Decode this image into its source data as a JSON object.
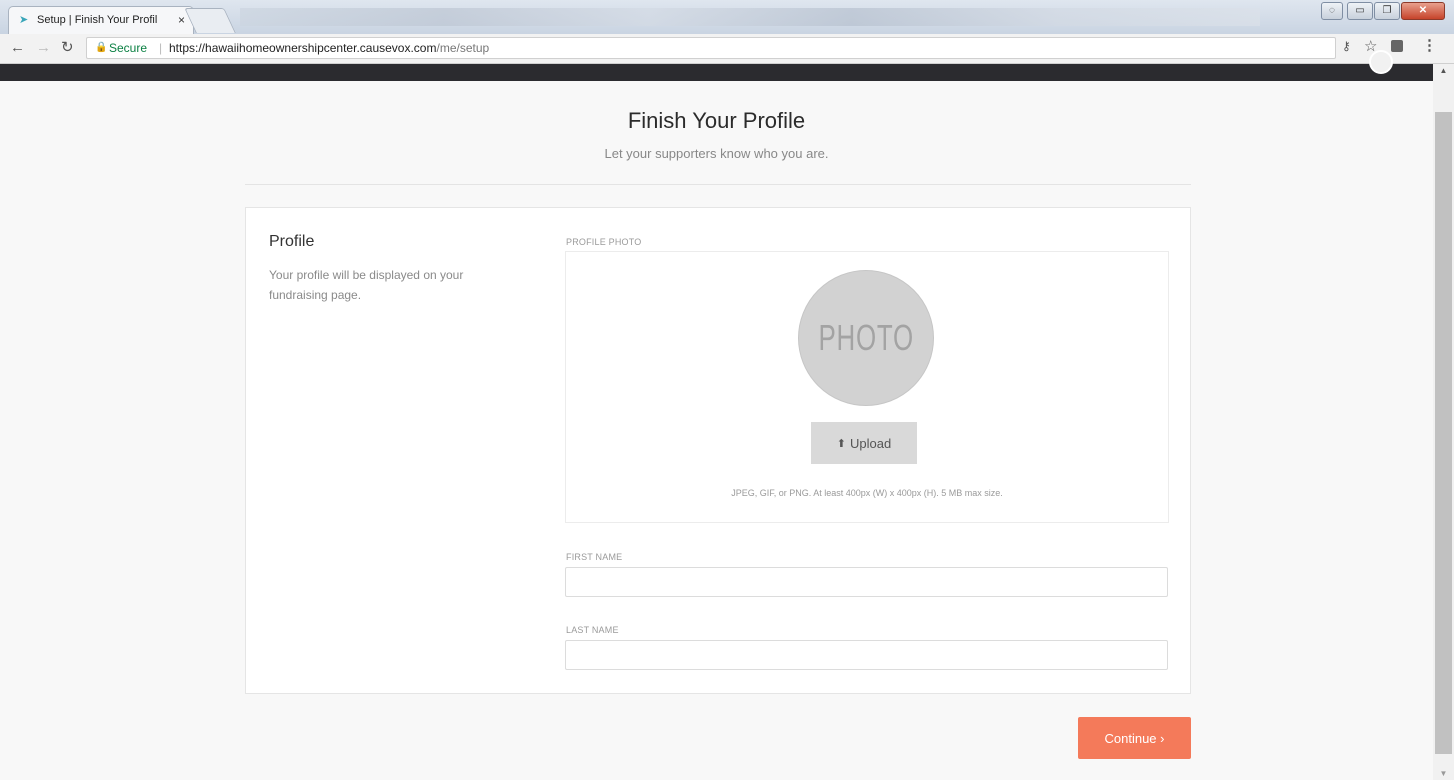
{
  "browser": {
    "tab_title": "Setup | Finish Your Profil",
    "tab_close": "×",
    "secure_label": "Secure",
    "url_host": "https://hawaiihomeownershipcenter.causevox.com",
    "url_path": "/me/setup"
  },
  "page": {
    "title": "Finish Your Profile",
    "subtitle": "Let your supporters know who you are."
  },
  "profile_section": {
    "title": "Profile",
    "description": "Your profile will be displayed on your fundraising page."
  },
  "photo": {
    "label": "PROFILE PHOTO",
    "placeholder_text": "PHOTO",
    "upload_label": "Upload",
    "hint": "JPEG, GIF, or PNG. At least 400px (W) x 400px (H). 5 MB max size."
  },
  "first_name": {
    "label": "FIRST NAME",
    "value": ""
  },
  "last_name": {
    "label": "LAST NAME",
    "value": ""
  },
  "continue_label": "Continue ›"
}
